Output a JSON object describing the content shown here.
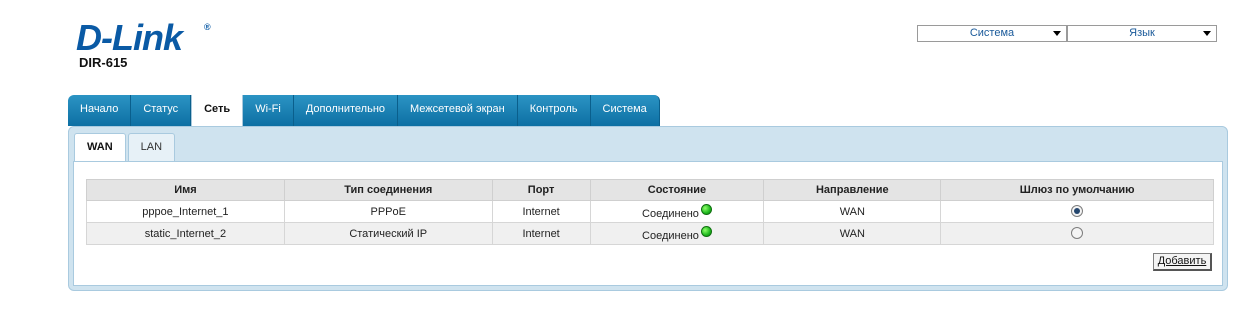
{
  "header": {
    "logo_text": "D-Link",
    "logo_mark": "®",
    "model": "DIR-615",
    "system_select": "Система",
    "language_select": "Язык"
  },
  "main_tabs": [
    {
      "label": "Начало"
    },
    {
      "label": "Статус"
    },
    {
      "label": "Сеть",
      "active": true
    },
    {
      "label": "Wi-Fi"
    },
    {
      "label": "Дополнительно"
    },
    {
      "label": "Межсетевой экран"
    },
    {
      "label": "Контроль"
    },
    {
      "label": "Система"
    }
  ],
  "sub_tabs": [
    {
      "label": "WAN",
      "active": true
    },
    {
      "label": "LAN"
    }
  ],
  "table": {
    "headers": [
      "Имя",
      "Тип соединения",
      "Порт",
      "Состояние",
      "Направление",
      "Шлюз по умолчанию"
    ],
    "rows": [
      {
        "name": "pppoe_Internet_1",
        "type": "PPPoE",
        "port": "Internet",
        "state": "Соединено",
        "direction": "WAN",
        "default_gateway": true
      },
      {
        "name": "static_Internet_2",
        "type": "Статический IP",
        "port": "Internet",
        "state": "Соединено",
        "direction": "WAN",
        "default_gateway": false
      }
    ]
  },
  "add_button": "Добавить",
  "colors": {
    "brand": "#0a5aa5",
    "tab_bg": "#1a7fb3",
    "panel_bg": "#cfe3ef",
    "status_ok": "#1eb81e"
  }
}
